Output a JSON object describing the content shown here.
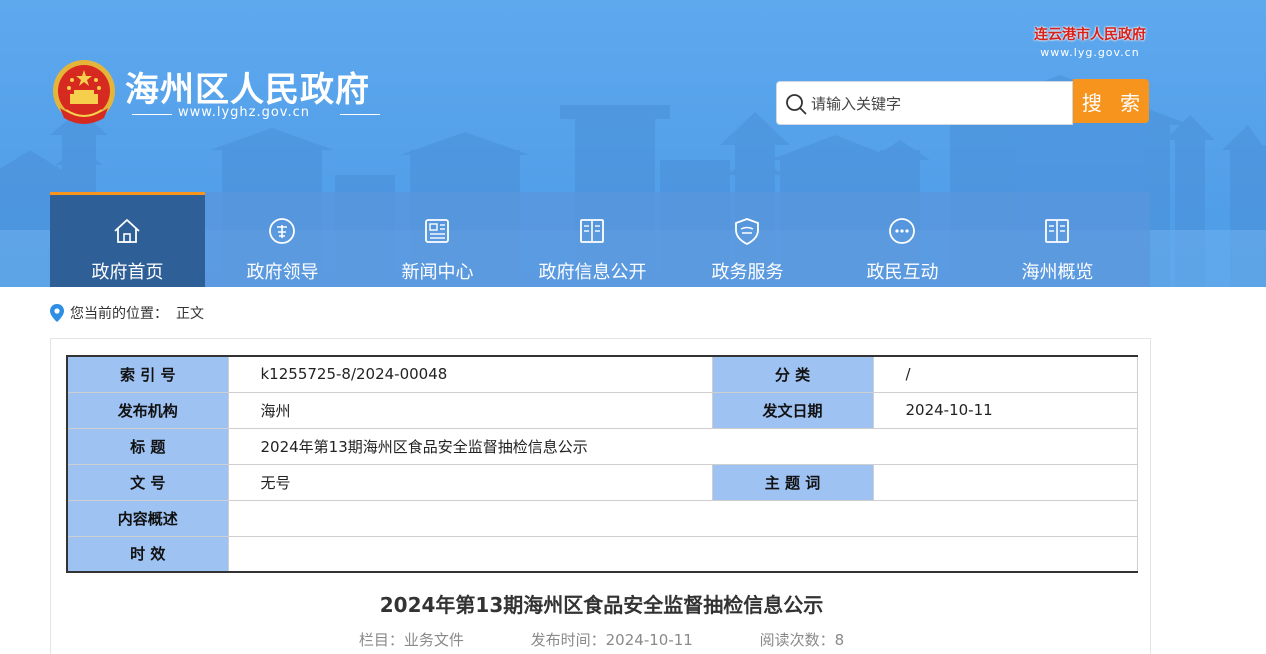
{
  "header": {
    "site_title": "海州区人民政府",
    "site_url": "www.lyghz.gov.cn",
    "city_name": "连云港市人民政府",
    "city_url": "www.lyg.gov.cn",
    "search_placeholder": "请输入关键字",
    "search_button": "搜 索"
  },
  "nav": {
    "items": [
      {
        "label": "政府首页",
        "icon": "home-icon"
      },
      {
        "label": "政府领导",
        "icon": "leader-icon"
      },
      {
        "label": "新闻中心",
        "icon": "news-icon"
      },
      {
        "label": "政府信息公开",
        "icon": "book-icon"
      },
      {
        "label": "政务服务",
        "icon": "shield-icon"
      },
      {
        "label": "政民互动",
        "icon": "chat-icon"
      },
      {
        "label": "海州概览",
        "icon": "book-icon"
      }
    ],
    "active_index": 0
  },
  "breadcrumb": {
    "label": "您当前的位置：",
    "current": "正文"
  },
  "meta": {
    "index_no_label": "索 引 号",
    "index_no": "k1255725-8/2024-00048",
    "category_label": "分 类",
    "category": "/",
    "publisher_label": "发布机构",
    "publisher": "海州",
    "date_label": "发文日期",
    "date": "2024-10-11",
    "title_label": "标 题",
    "title": "2024年第13期海州区食品安全监督抽检信息公示",
    "doc_no_label": "文 号",
    "doc_no": "无号",
    "keywords_label": "主 题 词",
    "keywords": "",
    "summary_label": "内容概述",
    "summary": "",
    "validity_label": "时 效",
    "validity": ""
  },
  "article": {
    "title": "2024年第13期海州区食品安全监督抽检信息公示",
    "column": "栏目：业务文件",
    "published": "发布时间：2024-10-11",
    "views": "阅读次数：8"
  },
  "colors": {
    "header_blue": "#5ea8ee",
    "nav_active": "#2f5f97",
    "accent_orange": "#f7941d",
    "table_key_bg": "#9ec2f2",
    "city_red": "#d9211b"
  }
}
